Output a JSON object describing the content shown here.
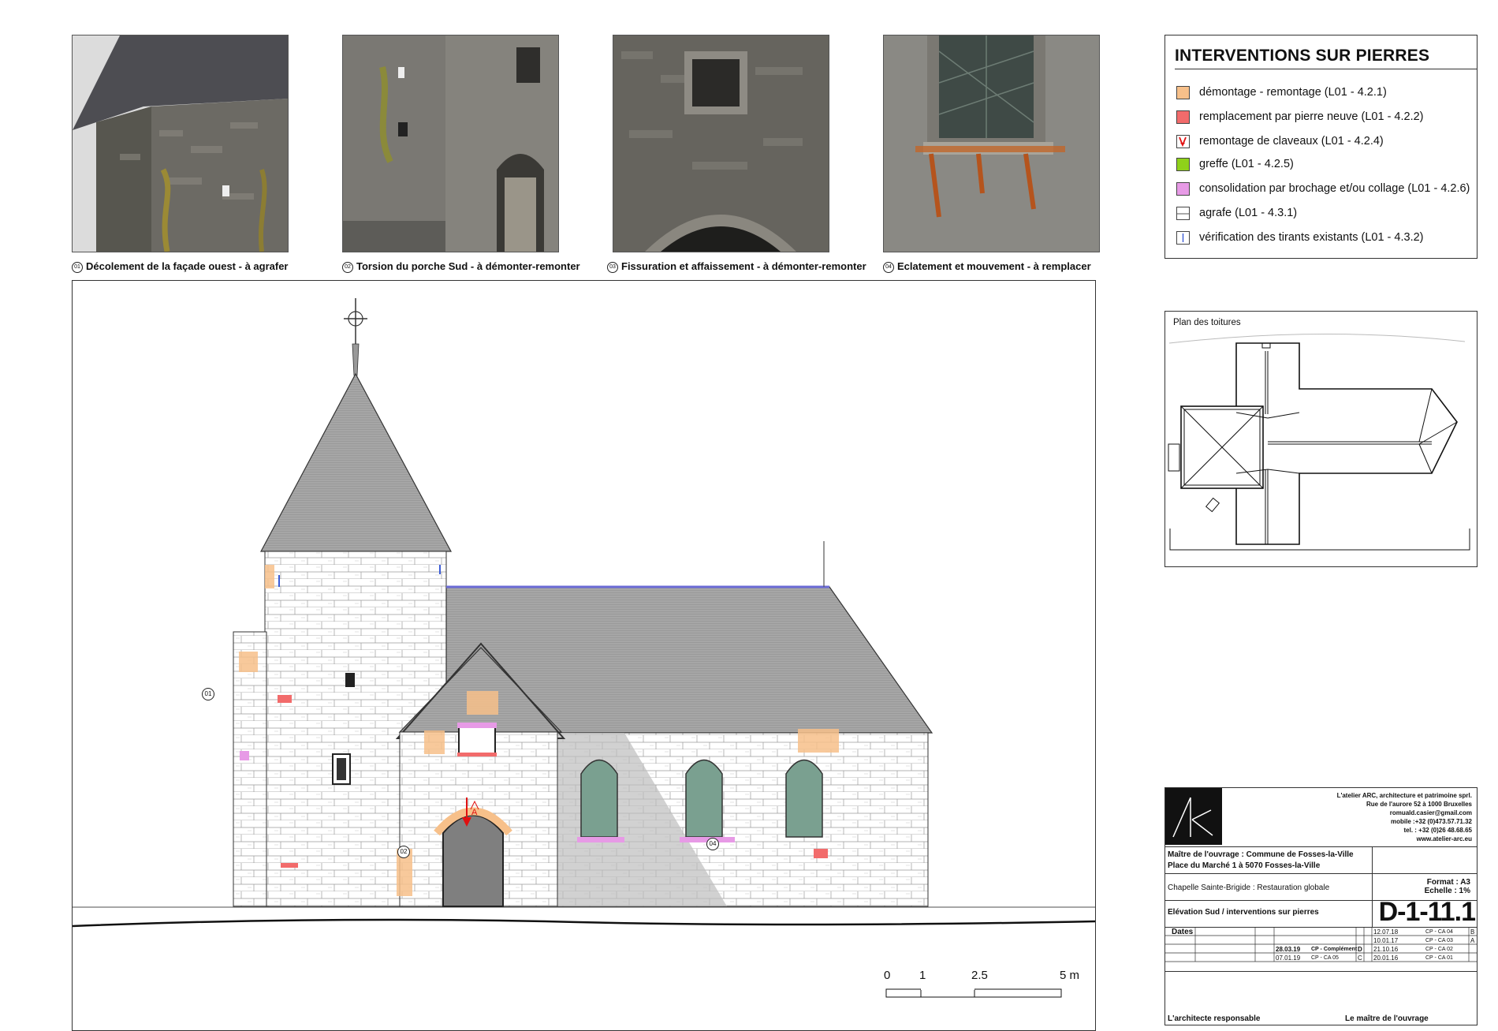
{
  "photos": [
    {
      "num": "01",
      "caption": "Décolement de la façade ouest - à agrafer"
    },
    {
      "num": "02",
      "caption": "Torsion du porche Sud - à démonter-remonter"
    },
    {
      "num": "03",
      "caption": "Fissuration et affaissement - à démonter-remonter"
    },
    {
      "num": "04",
      "caption": "Eclatement et mouvement - à remplacer"
    }
  ],
  "legend": {
    "title": "INTERVENTIONS SUR PIERRES",
    "items": [
      {
        "label": "démontage - remontage (L01 - 4.2.1)",
        "color": "#f7c08a",
        "icon": "orange-swatch"
      },
      {
        "label": "remplacement par pierre neuve (L01 - 4.2.2)",
        "color": "#f26b6b",
        "icon": "red-swatch"
      },
      {
        "label": "remontage de claveaux (L01 - 4.2.4)",
        "color": "#e01010",
        "icon": "red-arrow-icon"
      },
      {
        "label": "greffe  (L01 - 4.2.5)",
        "color": "#8fd11a",
        "icon": "green-swatch"
      },
      {
        "label": "consolidation par brochage et/ou collage  (L01 - 4.2.6)",
        "color": "#e79ae6",
        "icon": "violet-swatch"
      },
      {
        "label": "agrafe  (L01 - 4.3.1)",
        "color": "#ffffff",
        "icon": "staple-icon"
      },
      {
        "label": "vérification des tirants existants  (L01 - 4.3.2)",
        "color": "#3a5bd6",
        "icon": "tie-rod-icon"
      }
    ]
  },
  "roof_plan": {
    "title": "Plan des toitures"
  },
  "elevation": {
    "markers": [
      "01",
      "02",
      "04"
    ],
    "arrow_label": "A",
    "scale": [
      "0",
      "1",
      "2.5",
      "5 m"
    ]
  },
  "title_block": {
    "office": [
      "L'atelier ARC, architecture et patrimoine sprl.",
      "Rue de l'aurore 52 à 1000 Bruxelles",
      "romuald.casier@gmail.com",
      "mobile :+32 (0)473.57.71.32",
      "tel. : +32 (0)26 48.68.65",
      "www.atelier-arc.eu"
    ],
    "client_line1": "Maître de l'ouvrage : Commune de Fosses-la-Ville",
    "client_line2": "Place du Marché 1 à 5070 Fosses-la-Ville",
    "project": "Chapelle Sainte-Brigide : Restauration globale",
    "format": "Format : A3",
    "scale": "Echelle : 1%",
    "drawing_title": "Elévation Sud / interventions sur pierres",
    "drawing_number": "D-1-11.1",
    "dates_label": "Dates",
    "revisions_right": [
      {
        "date": "12.07.18",
        "code": "CP - CA 04",
        "letter": "B"
      },
      {
        "date": "10.01.17",
        "code": "CP - CA 03",
        "letter": "A"
      },
      {
        "date": "21.10.16",
        "code": "CP - CA 02",
        "letter": ""
      },
      {
        "date": "20.01.16",
        "code": "CP - CA 01",
        "letter": ""
      }
    ],
    "revisions_left": [
      {
        "date": "28.03.19",
        "code": "CP - Complément",
        "letter": "D"
      },
      {
        "date": "07.01.19",
        "code": "CP - CA 05",
        "letter": "C"
      }
    ],
    "architect": "L'architecte responsable",
    "owner": "Le maître de l'ouvrage"
  }
}
